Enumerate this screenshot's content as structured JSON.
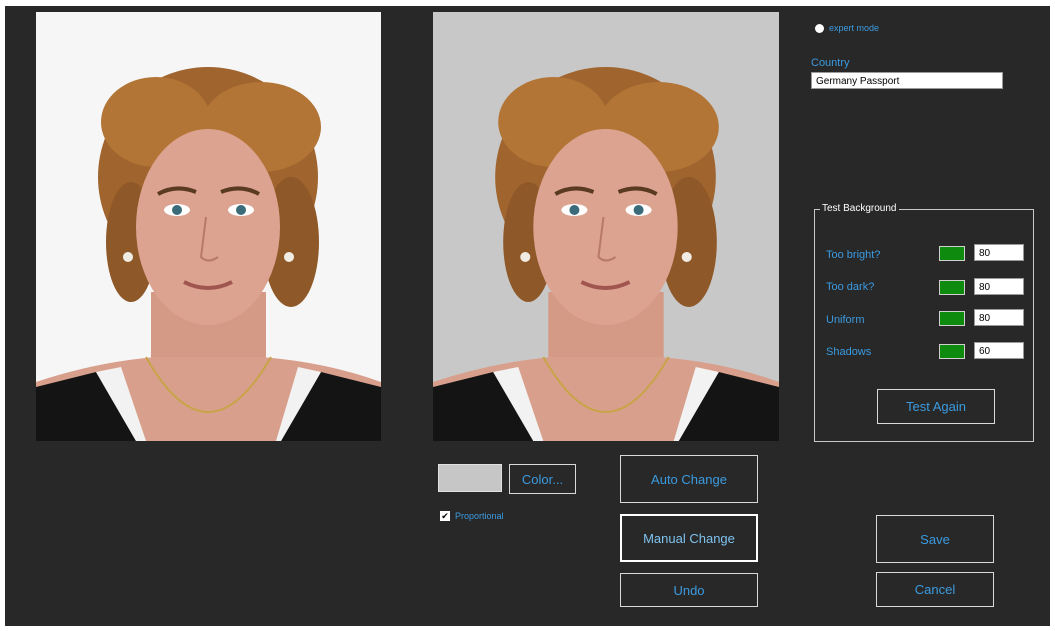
{
  "app": {
    "expert_mode_label": "expert mode",
    "country_label": "Country",
    "country_value": "Germany Passport",
    "color_button": "Color...",
    "proportional_label": "Proportional",
    "proportional_checked": true,
    "swatch_color": "#c6c6c6",
    "buttons": {
      "auto_change": "Auto Change",
      "manual_change": "Manual Change",
      "undo": "Undo",
      "save": "Save",
      "cancel": "Cancel",
      "test_again": "Test Again"
    },
    "test_background": {
      "title": "Test Background",
      "rows": [
        {
          "label": "Too bright?",
          "value": "80",
          "status_color": "#0e8a0e"
        },
        {
          "label": "Too dark?",
          "value": "80",
          "status_color": "#0e8a0e"
        },
        {
          "label": "Uniform",
          "value": "80",
          "status_color": "#0e8a0e"
        },
        {
          "label": "Shadows",
          "value": "60",
          "status_color": "#0e8a0e"
        }
      ]
    },
    "colors": {
      "window_bg": "#282828",
      "accent": "#3b9be0",
      "original_bg": "#f6f6f6",
      "processed_bg": "#c8c8c8"
    },
    "icons": [
      "radio-icon",
      "checkbox-icon"
    ]
  }
}
